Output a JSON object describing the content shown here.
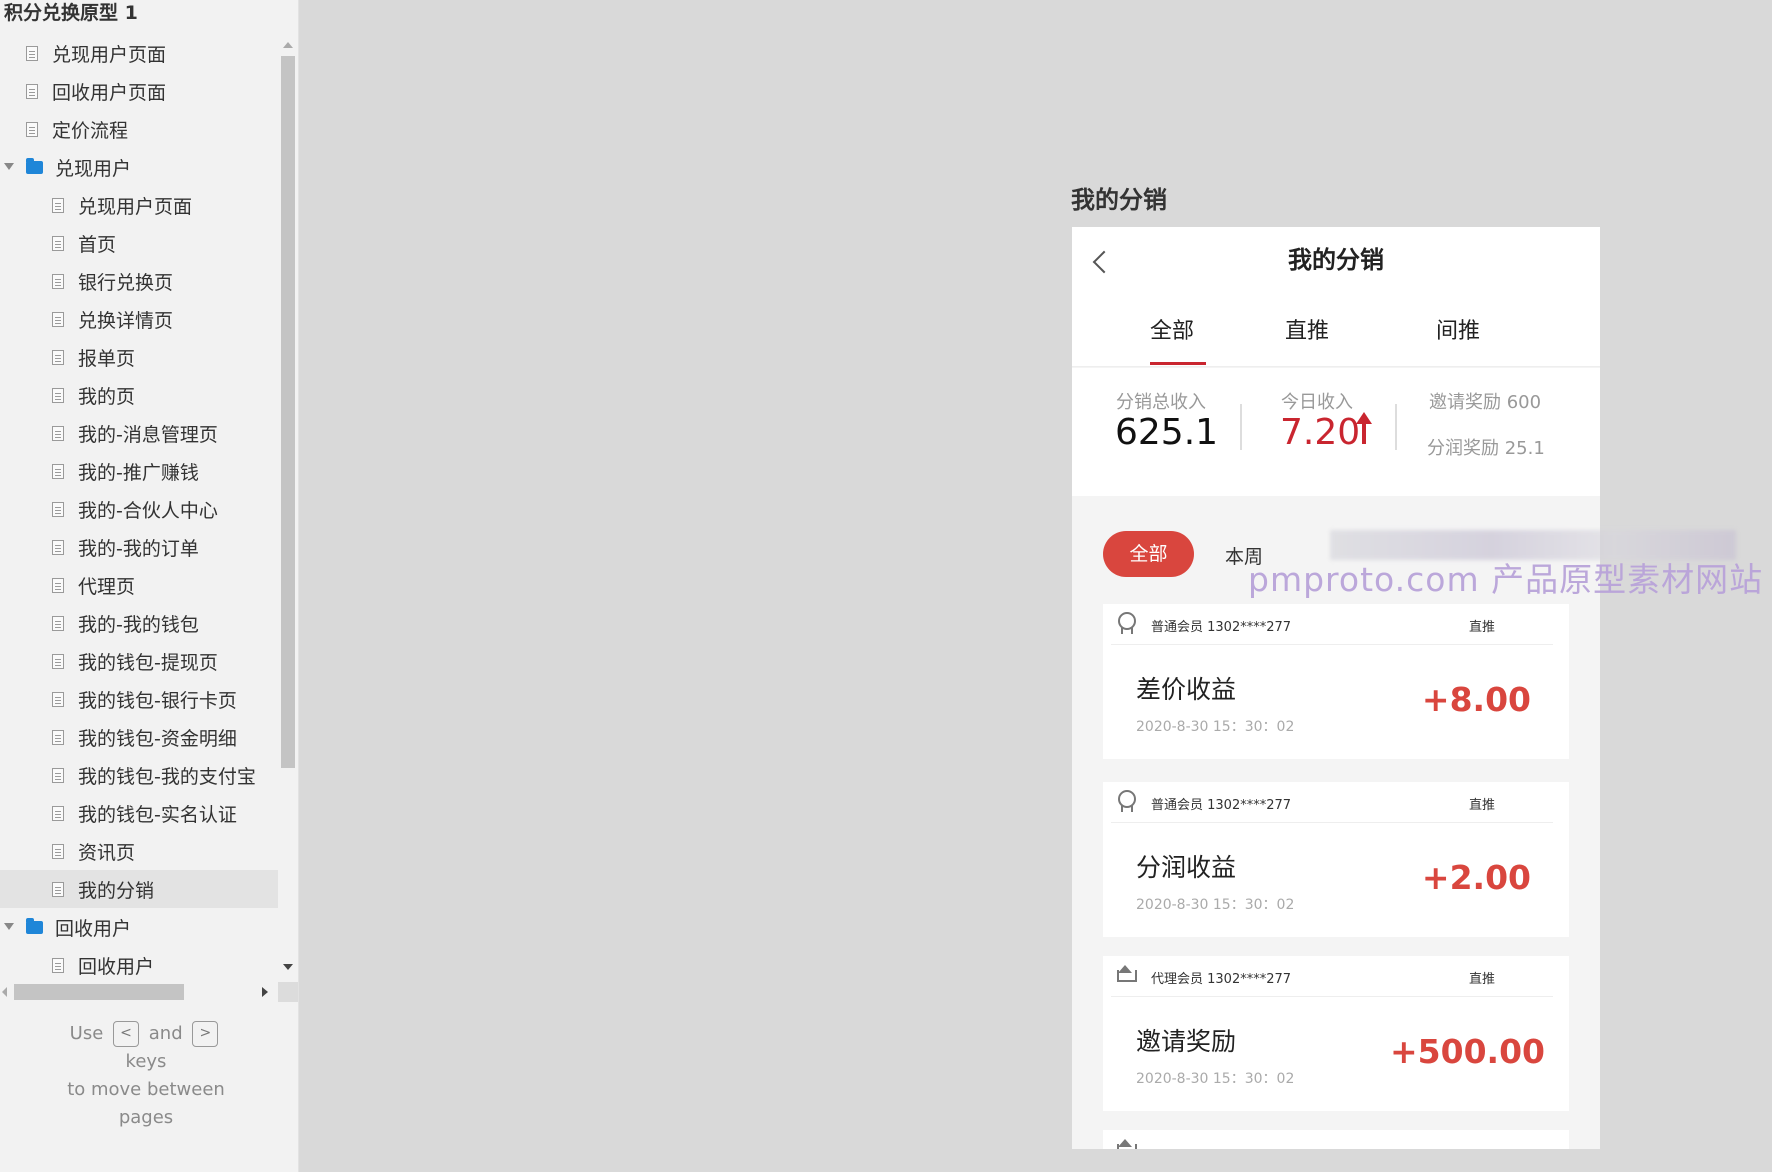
{
  "sidebar": {
    "title": "积分兑换原型 1",
    "items": [
      {
        "label": "兑现用户页面",
        "kind": "page",
        "level": 1
      },
      {
        "label": "回收用户页面",
        "kind": "page",
        "level": 1
      },
      {
        "label": "定价流程",
        "kind": "page",
        "level": 1
      },
      {
        "label": "兑现用户",
        "kind": "folder",
        "level": 1
      },
      {
        "label": "兑现用户页面",
        "kind": "page",
        "level": 2
      },
      {
        "label": "首页",
        "kind": "page",
        "level": 2
      },
      {
        "label": "银行兑换页",
        "kind": "page",
        "level": 2
      },
      {
        "label": "兑换详情页",
        "kind": "page",
        "level": 2
      },
      {
        "label": "报单页",
        "kind": "page",
        "level": 2
      },
      {
        "label": "我的页",
        "kind": "page",
        "level": 2
      },
      {
        "label": "我的-消息管理页",
        "kind": "page",
        "level": 2
      },
      {
        "label": "我的-推广赚钱",
        "kind": "page",
        "level": 2
      },
      {
        "label": "我的-合伙人中心",
        "kind": "page",
        "level": 2
      },
      {
        "label": "我的-我的订单",
        "kind": "page",
        "level": 2
      },
      {
        "label": "代理页",
        "kind": "page",
        "level": 2
      },
      {
        "label": "我的-我的钱包",
        "kind": "page",
        "level": 2
      },
      {
        "label": "我的钱包-提现页",
        "kind": "page",
        "level": 2
      },
      {
        "label": "我的钱包-银行卡页",
        "kind": "page",
        "level": 2
      },
      {
        "label": "我的钱包-资金明细",
        "kind": "page",
        "level": 2
      },
      {
        "label": "我的钱包-我的支付宝",
        "kind": "page",
        "level": 2
      },
      {
        "label": "我的钱包-实名认证",
        "kind": "page",
        "level": 2
      },
      {
        "label": "资讯页",
        "kind": "page",
        "level": 2
      },
      {
        "label": "我的分销",
        "kind": "page",
        "level": 2,
        "selected": true
      },
      {
        "label": "回收用户",
        "kind": "folder",
        "level": 1
      },
      {
        "label": "回收用户",
        "kind": "page",
        "level": 2
      }
    ],
    "hint": {
      "use": "Use",
      "prev_key": "<",
      "and": "and",
      "next_key": ">",
      "line2": "keys",
      "line3": "to move between",
      "line4": "pages"
    }
  },
  "page_label": "我的分销",
  "phone": {
    "nav_title": "我的分销",
    "tabs": [
      "全部",
      "直推",
      "间推"
    ],
    "active_tab": 0,
    "stats": {
      "total_label": "分销总收入",
      "total_value": "625.1",
      "today_label": "今日收入",
      "today_value": "7.20",
      "invite_reward": "邀请奖励 600",
      "share_reward": "分润奖励 25.1"
    },
    "filters": {
      "active": "全部",
      "week": "本周"
    },
    "watermark": "pmproto.com 产品原型素材网站",
    "cards": [
      {
        "member": "普通会员 1302****277",
        "type": "直推",
        "title": "差价收益",
        "time": "2020-8-30 15：30：02",
        "amount": "+8.00",
        "icon": "medal-icon"
      },
      {
        "member": "普通会员 1302****277",
        "type": "直推",
        "title": "分润收益",
        "time": "2020-8-30 15：30：02",
        "amount": "+2.00",
        "icon": "medal-icon"
      },
      {
        "member": "代理会员 1302****277",
        "type": "直推",
        "title": "邀请奖励",
        "time": "2020-8-30 15：30：02",
        "amount": "+500.00",
        "icon": "crown-icon"
      }
    ],
    "colors": {
      "accent": "#d9463e",
      "tab_underline": "#c9252f"
    }
  }
}
